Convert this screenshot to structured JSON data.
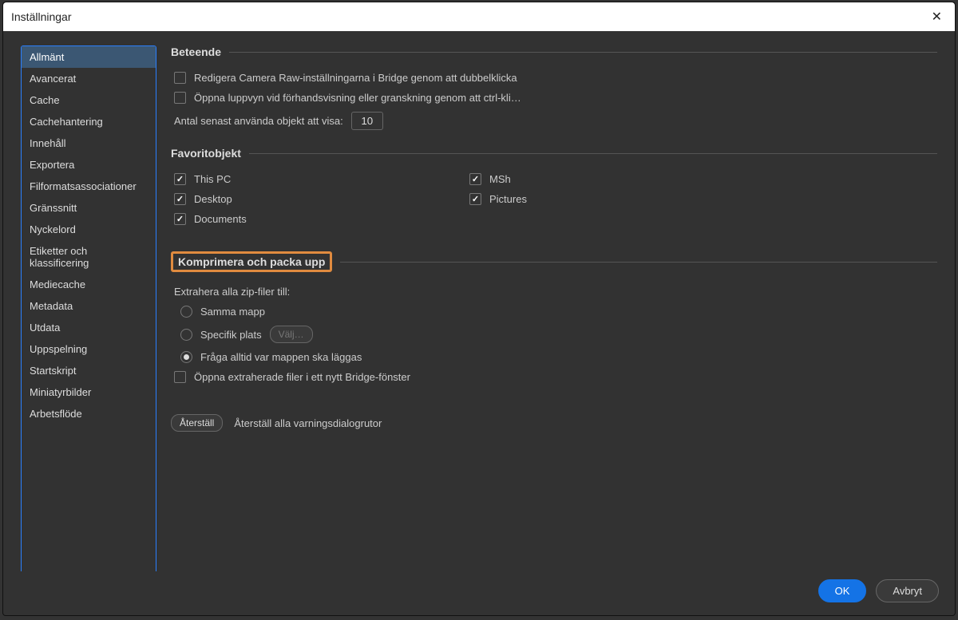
{
  "title": "Inställningar",
  "sidebar": {
    "items": [
      {
        "label": "Allmänt"
      },
      {
        "label": "Avancerat"
      },
      {
        "label": "Cache"
      },
      {
        "label": "Cachehantering"
      },
      {
        "label": "Innehåll"
      },
      {
        "label": "Exportera"
      },
      {
        "label": "Filformatsassociationer"
      },
      {
        "label": "Gränssnitt"
      },
      {
        "label": "Nyckelord"
      },
      {
        "label": "Etiketter och klassificering"
      },
      {
        "label": "Mediecache"
      },
      {
        "label": "Metadata"
      },
      {
        "label": "Utdata"
      },
      {
        "label": "Uppspelning"
      },
      {
        "label": "Startskript"
      },
      {
        "label": "Miniatyrbilder"
      },
      {
        "label": "Arbetsflöde"
      }
    ],
    "selected_index": 0
  },
  "sections": {
    "behavior": {
      "title": "Beteende",
      "edit_camera_raw": "Redigera Camera Raw-inställningarna i Bridge genom att dubbelklicka",
      "open_loupe": "Öppna luppvyn vid förhandsvisning eller granskning genom att ctrl-kli…",
      "recent_label": "Antal senast använda objekt att visa:",
      "recent_value": "10"
    },
    "favorites": {
      "title": "Favoritobjekt",
      "items_left": [
        "This PC",
        "Desktop",
        "Documents"
      ],
      "items_right": [
        "MSh",
        "Pictures"
      ]
    },
    "compress": {
      "title": "Komprimera och packa upp",
      "extract_label": "Extrahera alla zip-filer till:",
      "opt_same": "Samma mapp",
      "opt_specific": "Specifik plats",
      "choose_btn": "Välj…",
      "opt_ask": "Fråga alltid var mappen ska läggas",
      "open_extracted": "Öppna extraherade filer i ett nytt Bridge-fönster"
    },
    "reset": {
      "btn": "Återställ",
      "label": "Återställ alla varningsdialogrutor"
    }
  },
  "footer": {
    "ok": "OK",
    "cancel": "Avbryt"
  }
}
